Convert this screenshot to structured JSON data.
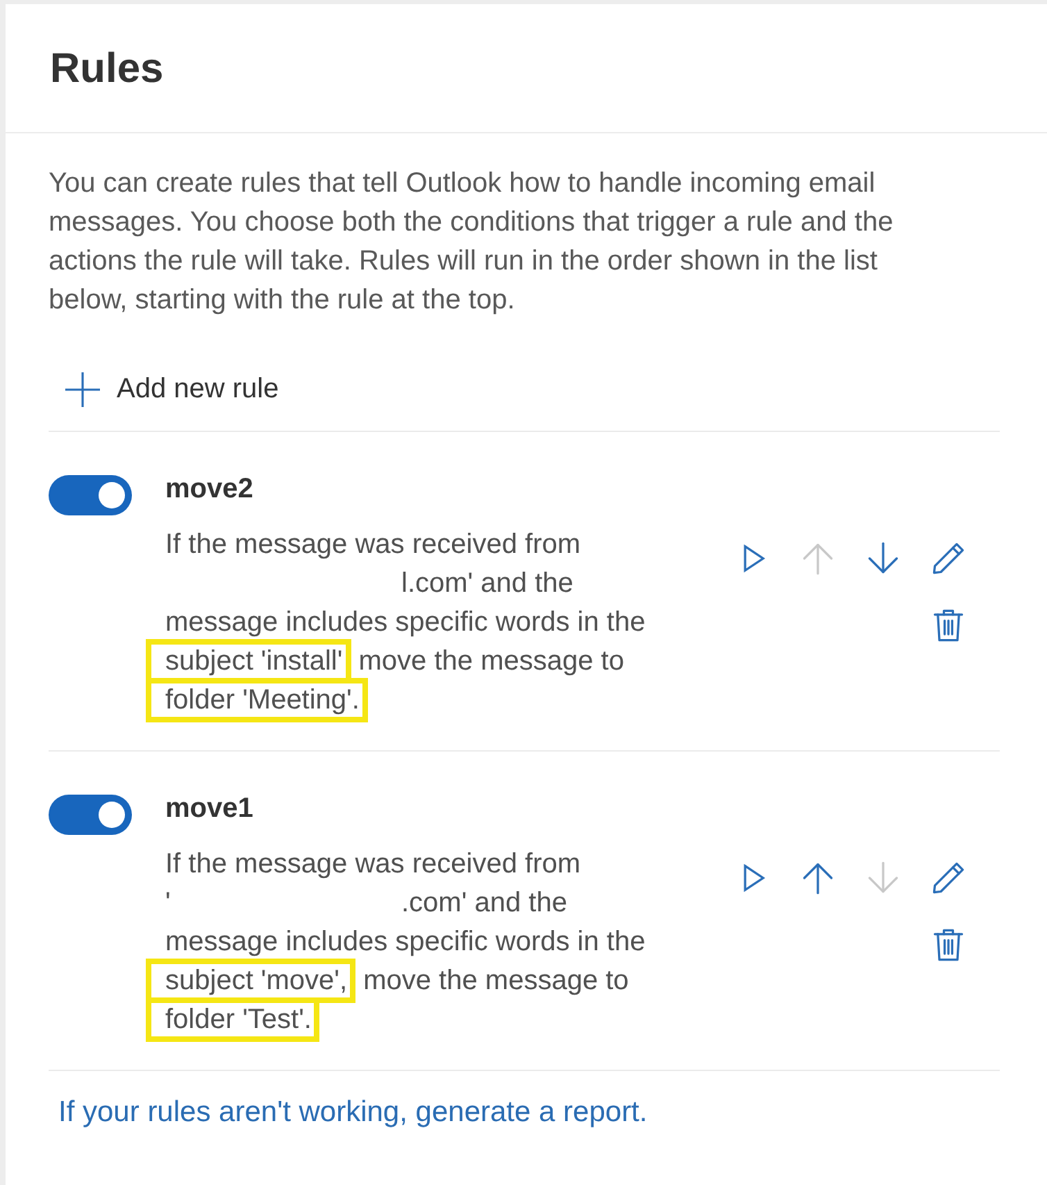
{
  "header": {
    "title": "Rules"
  },
  "intro": "You can create rules that tell Outlook how to handle incoming email messages. You choose both the conditions that trigger a rule and the actions the rule will take. Rules will run in the order shown in the list below, starting with the rule at the top.",
  "add_rule": {
    "label": "Add new rule"
  },
  "rules": [
    {
      "name": "move2",
      "enabled": true,
      "description": [
        {
          "kind": "text",
          "text": "If the message was received from"
        },
        {
          "kind": "redacted"
        },
        {
          "kind": "text",
          "text": "l.com' and the message includes specific words in the"
        },
        {
          "kind": "highlight",
          "text": "subject 'install'"
        },
        {
          "kind": "text",
          "text": "move the message to"
        },
        {
          "kind": "highlight",
          "text": "folder 'Meeting'."
        }
      ],
      "actions": [
        {
          "kind": "run",
          "disabled": false
        },
        {
          "kind": "move_up",
          "disabled": true
        },
        {
          "kind": "move_down",
          "disabled": false
        },
        {
          "kind": "edit",
          "disabled": false
        },
        {
          "kind": "delete",
          "disabled": false
        }
      ]
    },
    {
      "name": "move1",
      "enabled": true,
      "description": [
        {
          "kind": "text",
          "text": "If the message was received from"
        },
        {
          "kind": "redacted",
          "text": "'"
        },
        {
          "kind": "text",
          "text": ".com' and the message includes specific words in the"
        },
        {
          "kind": "highlight",
          "text": "subject 'move',"
        },
        {
          "kind": "text",
          "text": "move the message to"
        },
        {
          "kind": "highlight",
          "text": "folder 'Test'."
        }
      ],
      "actions": [
        {
          "kind": "run",
          "disabled": false
        },
        {
          "kind": "move_up",
          "disabled": false
        },
        {
          "kind": "move_down",
          "disabled": true
        },
        {
          "kind": "edit",
          "disabled": false
        },
        {
          "kind": "delete",
          "disabled": false
        }
      ]
    }
  ],
  "footer_link": "If your rules aren't working, generate a report."
}
